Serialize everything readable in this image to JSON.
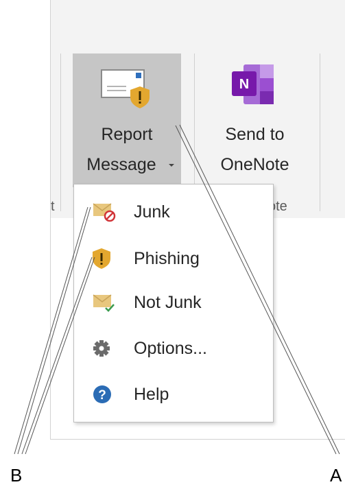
{
  "ribbon": {
    "report_message": {
      "line1": "Report",
      "line2": "Message",
      "icon": "report-message-icon"
    },
    "send_to_onenote": {
      "line1": "Send to",
      "line2": "OneNote",
      "icon": "onenote-icon",
      "icon_letter": "N"
    },
    "group_left_fragment": "t",
    "group_right_fragment": "ote"
  },
  "menu": {
    "items": [
      {
        "label": "Junk",
        "icon": "junk-icon"
      },
      {
        "label": "Phishing",
        "icon": "phishing-icon"
      },
      {
        "label": "Not Junk",
        "icon": "not-junk-icon"
      },
      {
        "label": "Options...",
        "icon": "gear-icon"
      },
      {
        "label": "Help",
        "icon": "help-icon"
      }
    ]
  },
  "callouts": {
    "a": "A",
    "b": "B"
  },
  "colors": {
    "onenote_purple": "#7719aa",
    "shield_gold": "#e3a72f",
    "envelope_tan": "#e8c77e",
    "help_blue": "#2b6cb5",
    "junk_red": "#d13438",
    "check_green": "#3a9b4f"
  }
}
